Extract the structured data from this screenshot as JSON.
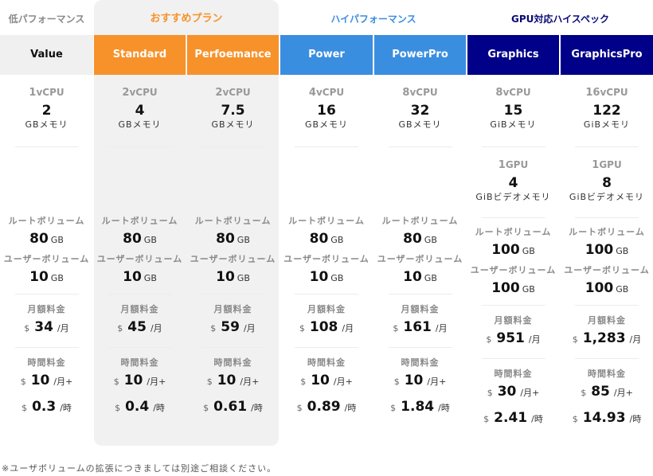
{
  "groups": {
    "low": "低パフォーマンス",
    "recommended": "おすすめプラン",
    "high": "ハイパフォーマンス",
    "gpu": "GPU対応ハイスペック"
  },
  "colors": {
    "value_header_bg": "#f0f0f0",
    "recommended_accent": "#f7922a",
    "high_accent": "#3a8ee0",
    "gpu_accent": "#000088",
    "recommended_panel_bg": "#f1f1f1"
  },
  "labels": {
    "memory_unit_gb": "GBメモリ",
    "memory_unit_gib": "GiBメモリ",
    "video_memory": "GiBビデオメモリ",
    "root_volume": "ルートボリューム",
    "user_volume": "ユーザーボリューム",
    "monthly_fee": "月額料金",
    "hourly_fee": "時間料金",
    "currency": "$",
    "per_month": "/月",
    "per_month_plus": "/月+",
    "per_hour": "/時",
    "vcpu": "vCPU",
    "gpu": "GPU",
    "gb": "GB"
  },
  "plans": [
    {
      "name": "Value",
      "vcpu": "1",
      "memory": "2",
      "memory_unit": "GBメモリ",
      "gpu": null,
      "vram": null,
      "root": "80",
      "user": "10",
      "monthly": "34",
      "hourly_base": "10",
      "hourly_rate": "0.3"
    },
    {
      "name": "Standard",
      "vcpu": "2",
      "memory": "4",
      "memory_unit": "GBメモリ",
      "gpu": null,
      "vram": null,
      "root": "80",
      "user": "10",
      "monthly": "45",
      "hourly_base": "10",
      "hourly_rate": "0.4"
    },
    {
      "name": "Perfoemance",
      "vcpu": "2",
      "memory": "7.5",
      "memory_unit": "GBメモリ",
      "gpu": null,
      "vram": null,
      "root": "80",
      "user": "10",
      "monthly": "59",
      "hourly_base": "10",
      "hourly_rate": "0.61"
    },
    {
      "name": "Power",
      "vcpu": "4",
      "memory": "16",
      "memory_unit": "GBメモリ",
      "gpu": null,
      "vram": null,
      "root": "80",
      "user": "10",
      "monthly": "108",
      "hourly_base": "10",
      "hourly_rate": "0.89"
    },
    {
      "name": "PowerPro",
      "vcpu": "8",
      "memory": "32",
      "memory_unit": "GBメモリ",
      "gpu": null,
      "vram": null,
      "root": "80",
      "user": "10",
      "monthly": "161",
      "hourly_base": "10",
      "hourly_rate": "1.84"
    },
    {
      "name": "Graphics",
      "vcpu": "8",
      "memory": "15",
      "memory_unit": "GiBメモリ",
      "gpu": "1",
      "vram": "4",
      "root": "100",
      "user": "100",
      "monthly": "951",
      "hourly_base": "30",
      "hourly_rate": "2.41"
    },
    {
      "name": "GraphicsPro",
      "vcpu": "16",
      "memory": "122",
      "memory_unit": "GiBメモリ",
      "gpu": "1",
      "vram": "8",
      "root": "100",
      "user": "100",
      "monthly": "1,283",
      "hourly_base": "85",
      "hourly_rate": "14.93"
    }
  ],
  "footnote": "※ユーザボリュームの拡張につきましては別途ご相談ください。"
}
